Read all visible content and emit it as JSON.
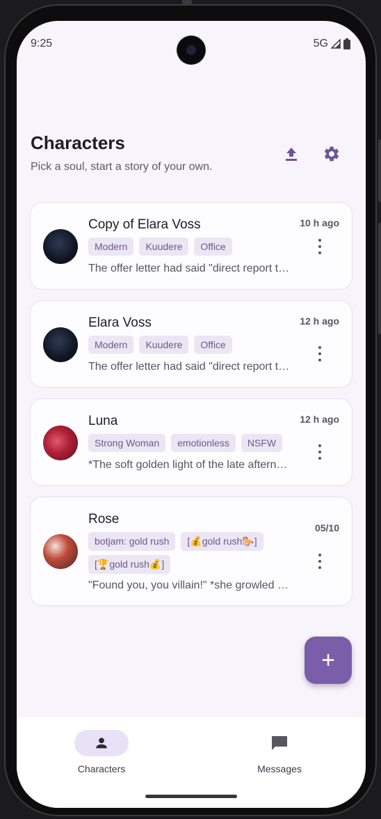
{
  "status_bar": {
    "time": "9:25",
    "network": "5G"
  },
  "header": {
    "title": "Characters",
    "subtitle": "Pick a soul, start a story of your own."
  },
  "icons": {
    "upload": "upload-icon",
    "settings": "gear-icon",
    "more": "more-vert-icon",
    "person": "person-icon",
    "messages": "chat-bubble-icon"
  },
  "colors": {
    "accent": "#7a5ea9",
    "tag_bg": "#ebe6f4",
    "tag_text": "#6a5a8c",
    "background": "#f7f5fb"
  },
  "characters": [
    {
      "name": "Copy of Elara Voss",
      "time": "10 h ago",
      "tags": [
        "Modern",
        "Kuudere",
        "Office"
      ],
      "preview": "The offer letter had said \"direct report to the CEO\"..."
    },
    {
      "name": "Elara Voss",
      "time": "12 h ago",
      "tags": [
        "Modern",
        "Kuudere",
        "Office"
      ],
      "preview": "The offer letter had said \"direct report to the CEO\"..."
    },
    {
      "name": "Luna",
      "time": "12 h ago",
      "tags": [
        "Strong Woman",
        "emotionless",
        "NSFW"
      ],
      "preview": "*The soft golden light of the late afternoon sun..."
    },
    {
      "name": "Rose",
      "time": "05/10",
      "tags": [
        "botjam: gold rush",
        "[💰gold rush🐎]",
        "[🏆gold rush💰]"
      ],
      "preview": "\"Found you, you villain!\" *she growled at him..."
    }
  ],
  "fab": {
    "label": "+"
  },
  "bottom_nav": {
    "characters_label": "Characters",
    "messages_label": "Messages"
  }
}
